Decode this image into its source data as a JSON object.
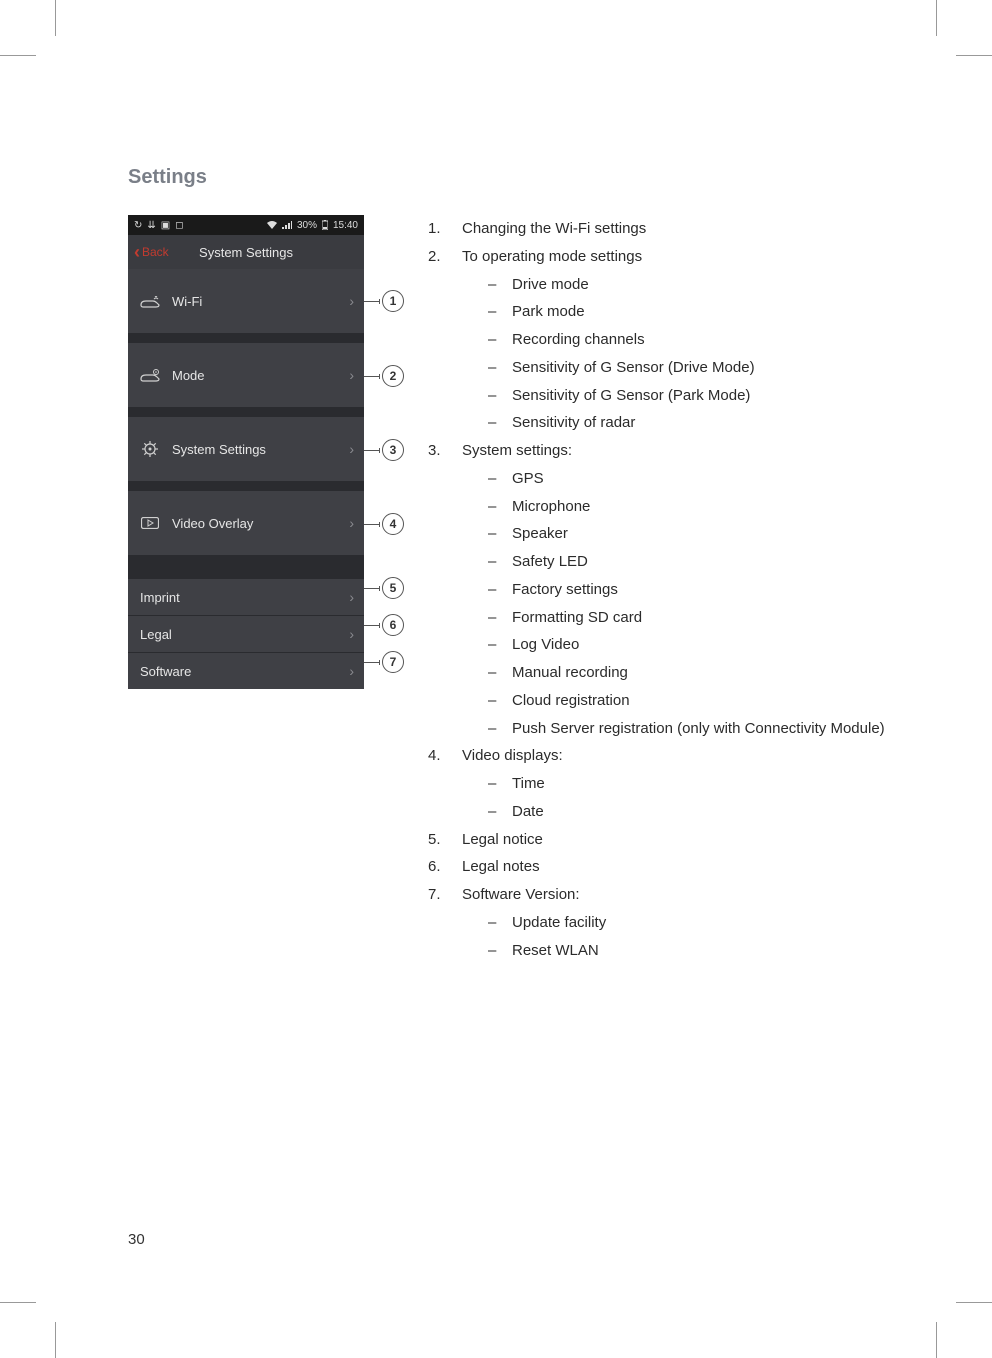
{
  "document": {
    "heading": "Settings",
    "page_number": "30"
  },
  "phone": {
    "statusbar": {
      "battery_text": "30%",
      "time": "15:40"
    },
    "titlebar": {
      "back_label": "Back",
      "title": "System Settings"
    },
    "rows": {
      "wifi": "Wi-Fi",
      "mode": "Mode",
      "system": "System Settings",
      "video": "Video Overlay",
      "imprint": "Imprint",
      "legal": "Legal",
      "software": "Software"
    }
  },
  "callouts": {
    "c1": "1",
    "c2": "2",
    "c3": "3",
    "c4": "4",
    "c5": "5",
    "c6": "6",
    "c7": "7"
  },
  "list": {
    "i1": "Changing the Wi-Fi settings",
    "i2": "To operating mode settings",
    "i2s": {
      "a": "Drive mode",
      "b": "Park mode",
      "c": "Recording channels",
      "d": "Sensitivity of G Sensor (Drive Mode)",
      "e": "Sensitivity of G Sensor (Park Mode)",
      "f": "Sensitivity of radar"
    },
    "i3": "System settings:",
    "i3s": {
      "a": "GPS",
      "b": "Microphone",
      "c": "Speaker",
      "d": "Safety LED",
      "e": "Factory settings",
      "f": "Formatting SD card",
      "g": "Log Video",
      "h": "Manual recording",
      "i": "Cloud registration",
      "j": "Push Server registration (only with Connectivity Module)"
    },
    "i4": "Video displays:",
    "i4s": {
      "a": "Time",
      "b": "Date"
    },
    "i5": "Legal notice",
    "i6": "Legal notes",
    "i7": "Software Version:",
    "i7s": {
      "a": "Update facility",
      "b": "Reset WLAN"
    }
  }
}
